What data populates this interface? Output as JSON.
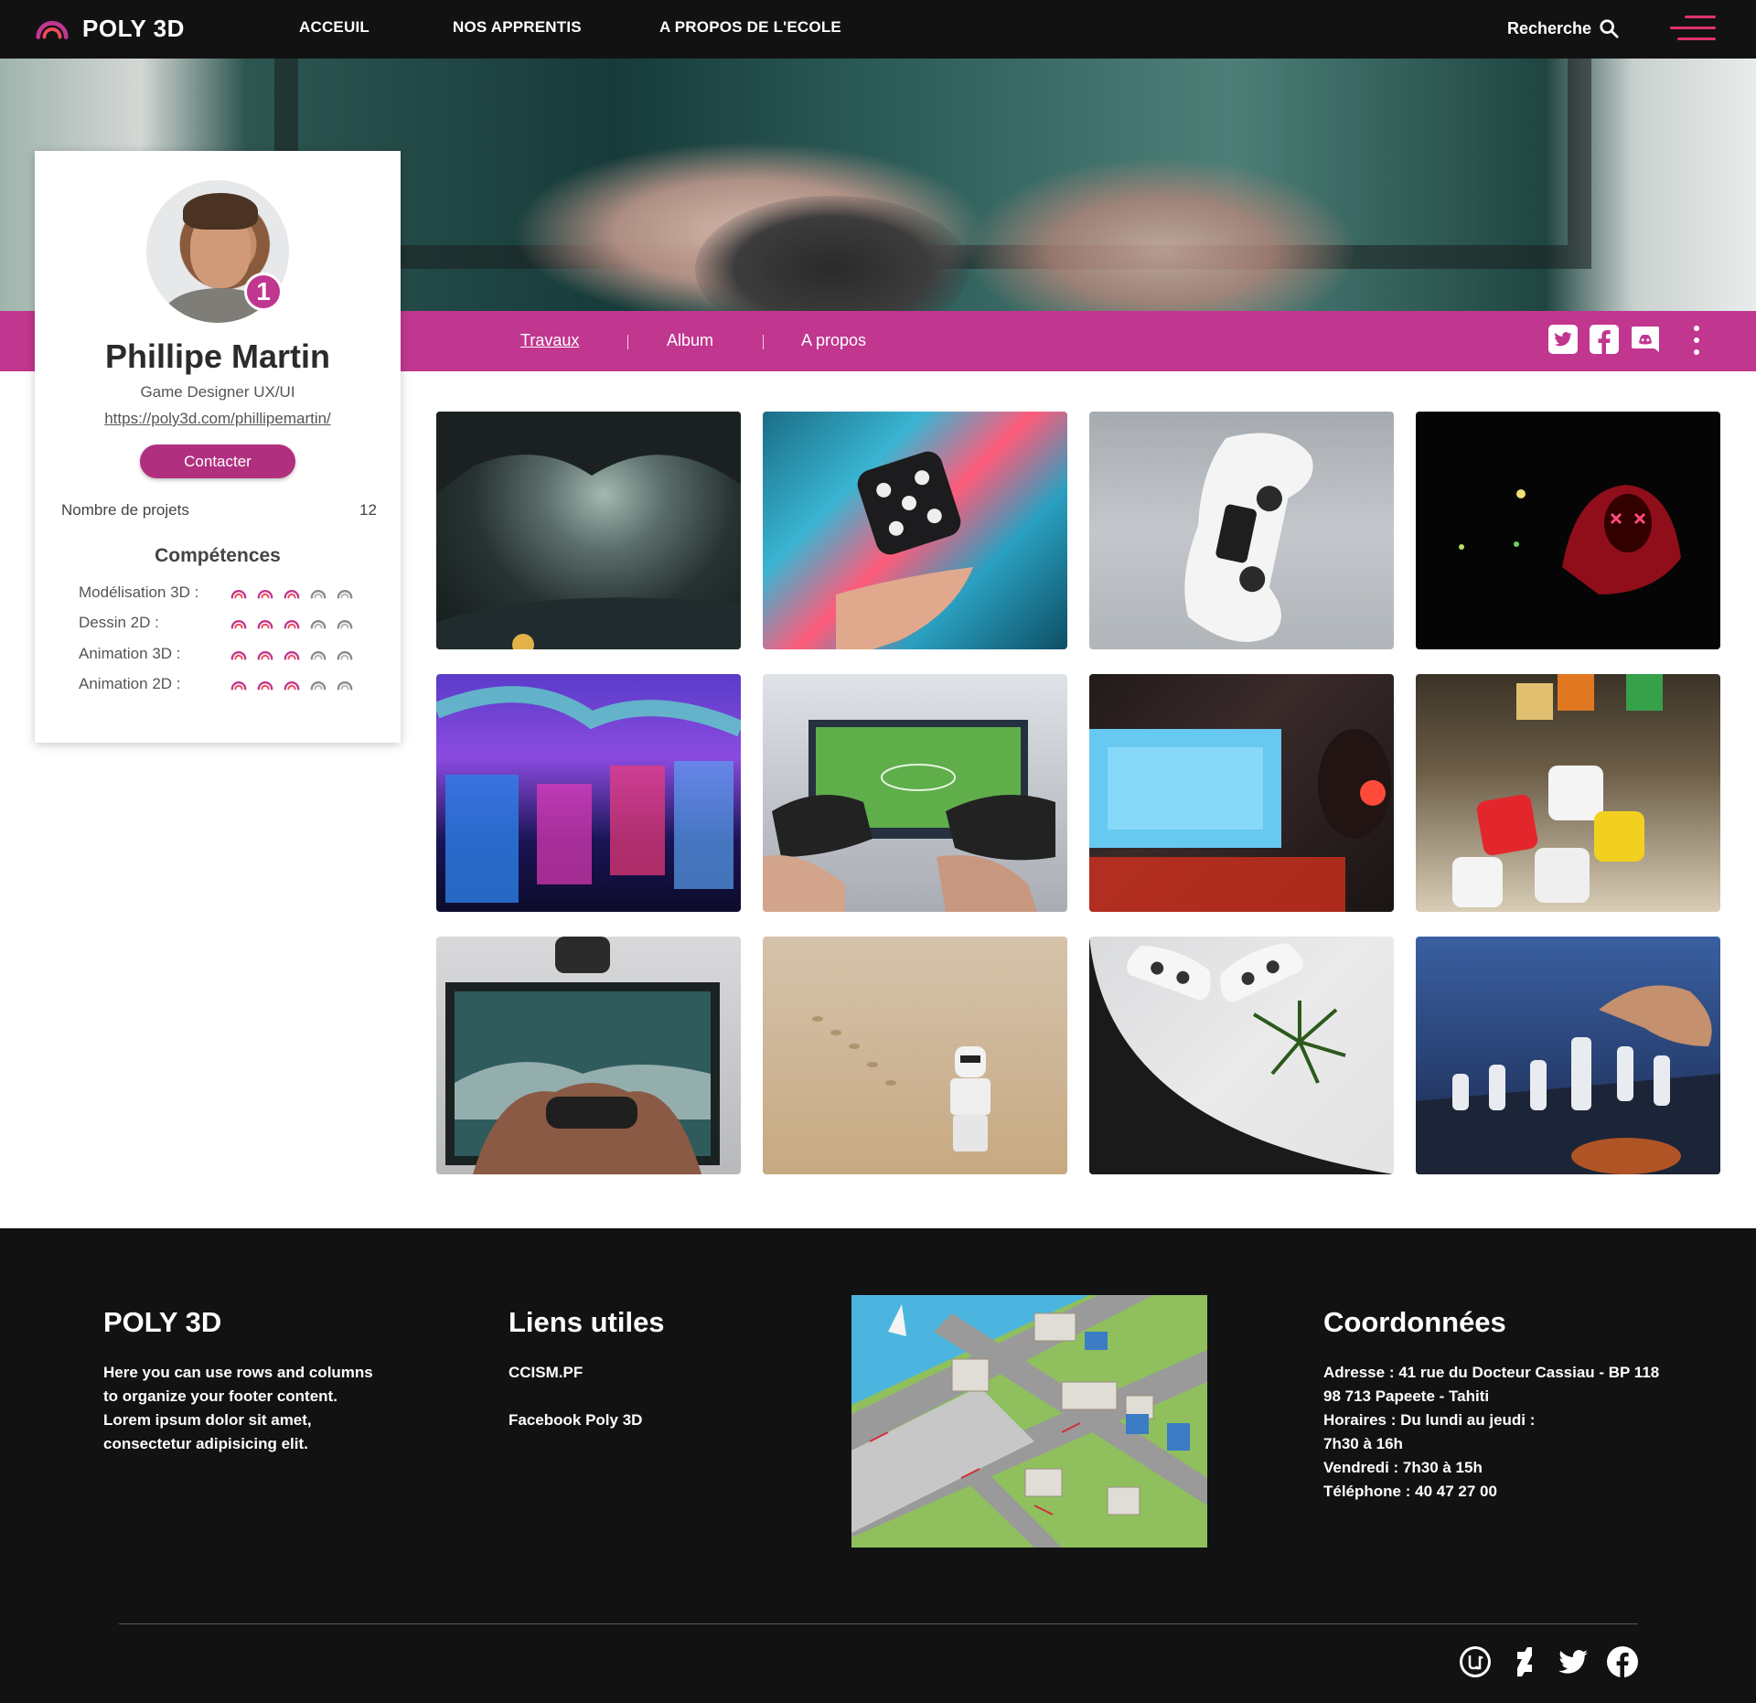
{
  "brand": {
    "name": "POLY 3D",
    "accent": "#c1368f",
    "logo_icon": "poly3d-logo"
  },
  "nav": {
    "links": [
      "ACCEUIL",
      "NOS APPRENTIS",
      "A PROPOS DE L'ECOLE"
    ],
    "search_label": "Recherche",
    "search_icon": "search-icon",
    "menu_icon": "hamburger-menu-icon"
  },
  "profile": {
    "name": "Phillipe Martin",
    "role": "Game Designer UX/UI",
    "url": "https://poly3d.com/phillipemartin/",
    "rank": "1",
    "contact_label": "Contacter",
    "stat": {
      "label": "Nombre de projets",
      "value": "12"
    },
    "skills_title": "Compétences",
    "skills": [
      {
        "label": "Modélisation 3D :",
        "level": 3,
        "max": 5
      },
      {
        "label": "Dessin 2D :",
        "level": 3,
        "max": 5
      },
      {
        "label": "Animation 3D :",
        "level": 3,
        "max": 5
      },
      {
        "label": "Animation 2D :",
        "level": 3,
        "max": 5
      }
    ]
  },
  "tabs": [
    {
      "label": "Travaux",
      "active": true
    },
    {
      "label": "Album",
      "active": false
    },
    {
      "label": "A propos",
      "active": false
    }
  ],
  "profile_social": [
    "twitter-icon",
    "facebook-icon",
    "discord-icon",
    "more-options-icon"
  ],
  "gallery": [
    "cave-explorer-image",
    "floating-dice-image",
    "white-gamepad-image",
    "neon-mask-image",
    "arcade-room-image",
    "football-game-controllers-image",
    "gamer-headset-image",
    "board-game-dice-image",
    "playing-console-image",
    "stormtrooper-sand-image",
    "gamepads-plant-image",
    "chess-hand-image"
  ],
  "footer": {
    "col1": {
      "title": "POLY 3D",
      "text": [
        "Here you can use rows and columns",
        "to organize your footer content.",
        "Lorem ipsum dolor sit amet,",
        "consectetur adipisicing elit."
      ]
    },
    "col2": {
      "title": "Liens utiles",
      "links": [
        "CCISM.PF",
        "Facebook Poly 3D"
      ]
    },
    "col3": {
      "map_icon": "campus-map-image"
    },
    "col4": {
      "title": "Coordonnées",
      "lines": [
        "Adresse : 41 rue du Docteur Cassiau - BP 118",
        "98 713 Papeete - Tahiti",
        "Horaires : Du lundi au jeudi :",
        "7h30 à 16h",
        "Vendredi : 7h30 à 15h",
        "Téléphone : 40 47 27 00"
      ]
    },
    "social": [
      "unreal-engine-icon",
      "deviantart-icon",
      "twitter-icon",
      "facebook-icon"
    ]
  }
}
